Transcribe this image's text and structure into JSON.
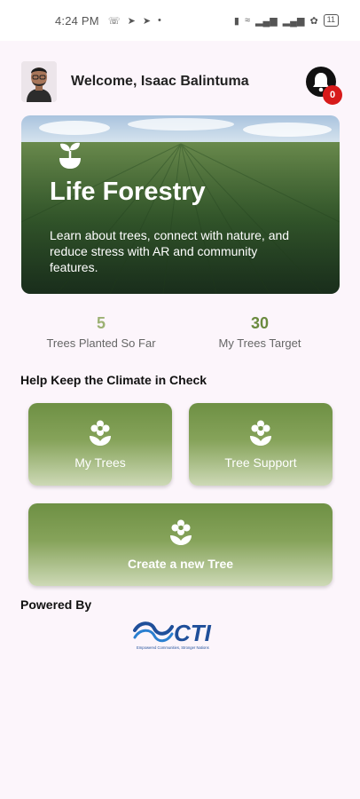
{
  "status_bar": {
    "time": "4:24 PM",
    "battery": "11"
  },
  "header": {
    "welcome": "Welcome, Isaac Balintuma",
    "notification_count": "0"
  },
  "banner": {
    "title": "Life Forestry",
    "description": "Learn about trees, connect with nature, and reduce stress with AR and community features."
  },
  "stats": [
    {
      "value": "5",
      "label": "Trees Planted So Far"
    },
    {
      "value": "30",
      "label": "My Trees Target"
    }
  ],
  "section_title": "Help Keep the Climate in Check",
  "tiles": {
    "my_trees": "My Trees",
    "tree_support": "Tree Support",
    "create_tree": "Create a new Tree"
  },
  "footer": {
    "powered_by": "Powered By",
    "logo_text": "CTI",
    "logo_tagline": "Empowered Communities, Stronger Nations"
  },
  "colors": {
    "accent_green": "#6e9044",
    "stat_light": "#9cb173",
    "badge_red": "#d71a1a",
    "logo_blue": "#1f4f9a"
  },
  "icons": [
    "whatsapp-icon",
    "telegram-icon",
    "bell-icon",
    "sprout-icon",
    "flower-icon",
    "battery-icon",
    "wifi-icon",
    "signal-icon"
  ]
}
